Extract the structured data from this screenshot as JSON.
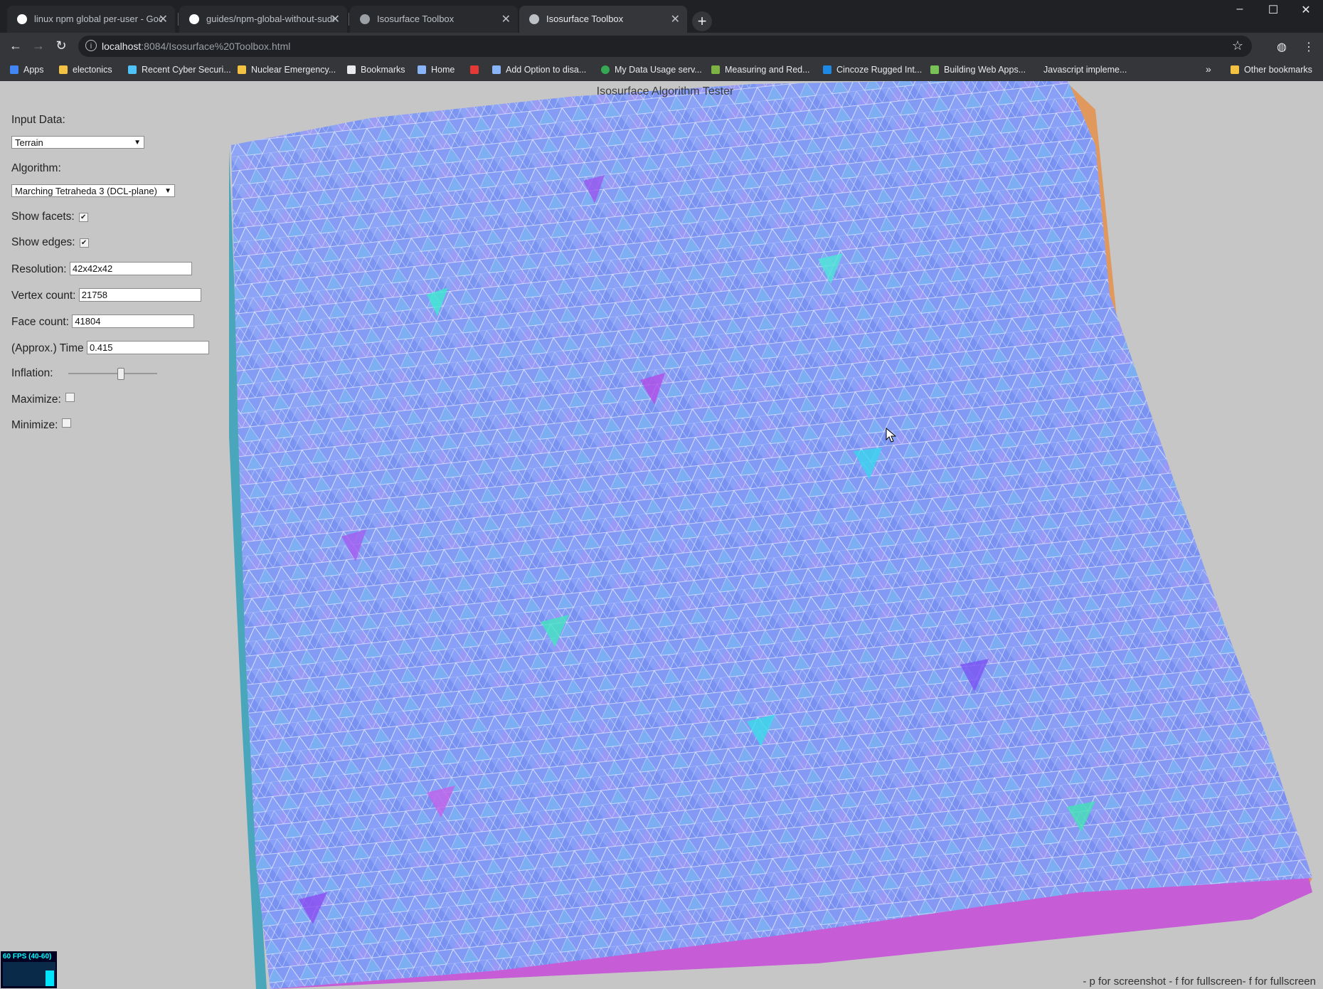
{
  "browser": {
    "tabs": [
      {
        "title": "linux npm global per-user - Goo",
        "favicon": "google-icon",
        "color": "#ffffff",
        "active": false
      },
      {
        "title": "guides/npm-global-without-sudo",
        "favicon": "github-icon",
        "color": "#ffffff",
        "active": false
      },
      {
        "title": "Isosurface Toolbox",
        "favicon": "globe-icon",
        "color": "#bdc1c6",
        "active": false
      },
      {
        "title": "Isosurface Toolbox",
        "favicon": "globe-icon",
        "color": "#bdc1c6",
        "active": true
      }
    ],
    "new_tab": "+",
    "url_host": "localhost",
    "url_rest": ":8084/Isosurface%20Toolbox.html",
    "bookmarks": [
      {
        "label": "Apps",
        "icon": "apps-grid-icon",
        "color": "#4285f4"
      },
      {
        "label": "electonics",
        "icon": "folder-icon",
        "color": "#f4c242"
      },
      {
        "label": "Recent Cyber Securi...",
        "icon": "bookmark-icon",
        "color": "#4fc3f7"
      },
      {
        "label": "Nuclear Emergency...",
        "icon": "radiation-icon",
        "color": "#f4c242"
      },
      {
        "label": "Bookmarks",
        "icon": "star-icon",
        "color": "#e8eaed"
      },
      {
        "label": "Home",
        "icon": "w-icon",
        "color": "#8ab4f8"
      },
      {
        "label": "",
        "icon": "r-icon",
        "color": "#e53935"
      },
      {
        "label": "Add Option to disa...",
        "icon": "a-icon",
        "color": "#8ab4f8"
      },
      {
        "label": "My Data Usage serv...",
        "icon": "circle-icon",
        "color": "#34a853"
      },
      {
        "label": "Measuring and Red...",
        "icon": "doc-icon",
        "color": "#7cb342"
      },
      {
        "label": "Cincoze Rugged Int...",
        "icon": "shield-icon",
        "color": "#1e88e5"
      },
      {
        "label": "Building Web Apps...",
        "icon": "android-icon",
        "color": "#78c257"
      },
      {
        "label": "Javascript impleme...",
        "icon": "",
        "color": "#35363a"
      }
    ],
    "overflow": "»",
    "other_bookmarks": "Other bookmarks"
  },
  "app": {
    "title": "Isosurface Algorithm Tester",
    "input_data_label": "Input Data:",
    "input_data_value": "Terrain",
    "algorithm_label": "Algorithm:",
    "algorithm_value": "Marching Tetraheda 3 (DCL-plane)",
    "show_facets_label": "Show facets:",
    "show_facets_checked": true,
    "show_edges_label": "Show edges:",
    "show_edges_checked": true,
    "resolution_label": "Resolution:",
    "resolution_value": "42x42x42",
    "vertex_count_label": "Vertex count:",
    "vertex_count_value": "21758",
    "face_count_label": "Face count:",
    "face_count_value": "41804",
    "time_label": "(Approx.) Time",
    "time_value": "0.415",
    "inflation_label": "Inflation:",
    "inflation_level": 0.58,
    "maximize_label": "Maximize:",
    "minimize_label": "Minimize:",
    "fps_label": "60 FPS (40-60)",
    "footer_hint": "- p for screenshot - f for fullscreen- f for fullscreen"
  }
}
